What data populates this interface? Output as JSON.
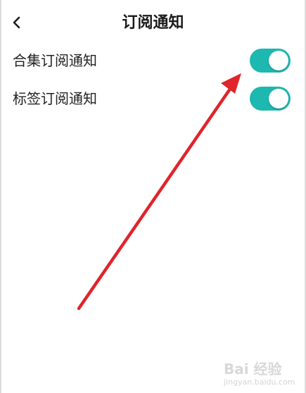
{
  "header": {
    "title": "订阅通知",
    "back_icon": "chevron-left-icon"
  },
  "settings": [
    {
      "label": "合集订阅通知",
      "enabled": true
    },
    {
      "label": "标签订阅通知",
      "enabled": true
    }
  ],
  "colors": {
    "toggle_on": "#1db8b0",
    "arrow": "#e0242b"
  },
  "watermark": {
    "logo": "Bai 经验",
    "url": "jingyan.baidu.com"
  }
}
